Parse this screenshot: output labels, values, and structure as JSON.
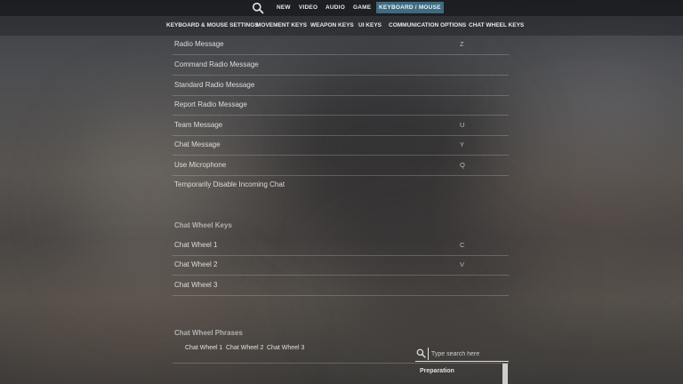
{
  "top_nav": {
    "items": [
      "NEW",
      "VIDEO",
      "AUDIO",
      "GAME",
      "KEYBOARD / MOUSE"
    ],
    "active": "KEYBOARD / MOUSE"
  },
  "sub_nav": {
    "items": [
      "KEYBOARD & MOUSE SETTINGS",
      "MOVEMENT KEYS",
      "WEAPON KEYS",
      "UI KEYS",
      "COMMUNICATION OPTIONS",
      "CHAT WHEEL KEYS"
    ]
  },
  "communication_rows": [
    {
      "label": "Radio Message",
      "key": "Z"
    },
    {
      "label": "Command Radio Message",
      "key": ""
    },
    {
      "label": "Standard Radio Message",
      "key": ""
    },
    {
      "label": "Report Radio Message",
      "key": ""
    },
    {
      "label": "Team Message",
      "key": "U"
    },
    {
      "label": "Chat Message",
      "key": "Y"
    },
    {
      "label": "Use Microphone",
      "key": "Q"
    },
    {
      "label": "Temporarily Disable Incoming Chat",
      "key": ""
    }
  ],
  "chat_wheel_keys": {
    "title": "Chat Wheel Keys",
    "rows": [
      {
        "label": "Chat Wheel 1",
        "key": "C"
      },
      {
        "label": "Chat Wheel 2",
        "key": "V"
      },
      {
        "label": "Chat Wheel 3",
        "key": ""
      }
    ]
  },
  "chat_wheel_phrases": {
    "title": "Chat Wheel Phrases",
    "tabs": [
      "Chat Wheel 1",
      "Chat Wheel 2",
      "Chat Wheel 3"
    ],
    "search_placeholder": "Type search here",
    "category": "Preparation"
  },
  "icons": {
    "nav_search": "search-icon",
    "phrase_search": "search-icon"
  },
  "colors": {
    "active_tab": "#3f6b80",
    "text": "#dcdcdc"
  }
}
